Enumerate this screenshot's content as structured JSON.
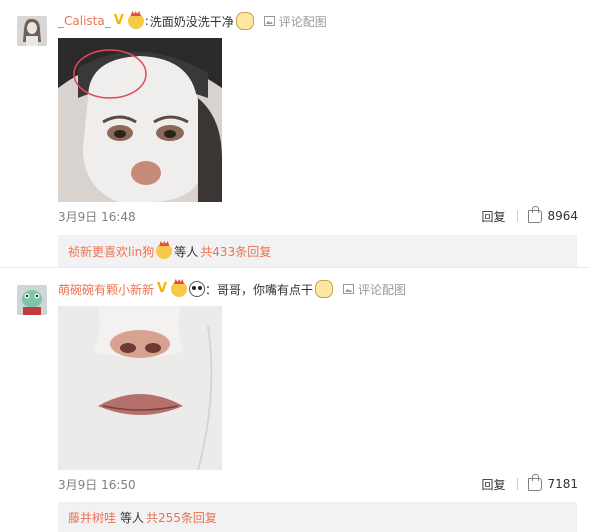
{
  "comments": [
    {
      "username": "_Calista_",
      "colon": ":",
      "text": "洗面奶没洗干净",
      "pic_link": "评论配图",
      "time": "3月9日 16:48",
      "reply": "回复",
      "likes": "8964",
      "sub": {
        "liker": "祯新更喜欢lin狗",
        "others": "等人",
        "more": "共433条回复"
      }
    },
    {
      "username": "萌碗碗有颗小新新",
      "colon": "",
      "text": "：哥哥，你嘴有点干",
      "pic_link": "评论配图",
      "time": "3月9日 16:50",
      "reply": "回复",
      "likes": "7181",
      "sub": {
        "liker": "藤井树哇",
        "others": "等人",
        "more": "共255条回复"
      }
    }
  ],
  "colors": {
    "accent": "#eb7350",
    "meta": "#808080",
    "sub_bg": "#f2f2f5"
  }
}
